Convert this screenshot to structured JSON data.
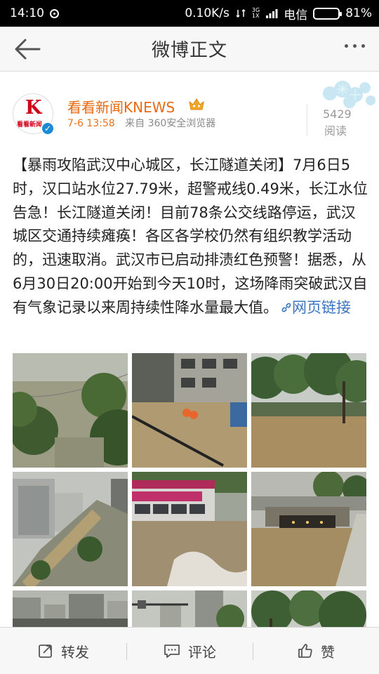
{
  "status_bar": {
    "time": "14:10",
    "net_speed": "0.10K/s",
    "net_type_top": "3G",
    "net_type_bottom": "1X",
    "carrier": "电信",
    "battery": "81%",
    "battery_level": 0.81
  },
  "nav": {
    "title": "微博正文"
  },
  "post": {
    "username": "看看新闻KNEWS",
    "date": "7-6 13:58",
    "source": "来自 360安全浏览器",
    "read_count": "5429",
    "read_label": "阅读",
    "avatar_logo": "K",
    "avatar_text": "看看新闻",
    "text": "【暴雨攻陷武汉中心城区，长江隧道关闭】7月6日5时，汉口站水位27.79米，超警戒线0.49米，长江水位告急！长江隧道关闭！目前78条公交线路停运，武汉城区交通持续瘫痪！各区各学校仍然有组织教学活动的，迅速取消。武汉市已启动排渍红色预警！据悉，从6月30日20:00开始到今天10时，这场降雨突破武汉自有气象记录以来周持续性降水量最大值。",
    "link_text": "网页链接",
    "images": [
      "photo-flooded-riverside",
      "photo-street-rescue",
      "photo-flooded-park",
      "photo-aerial-flooded-road",
      "photo-bus-in-flood",
      "photo-flooded-tunnel",
      "photo-city-buildings",
      "photo-street-lamp",
      "photo-trees"
    ]
  },
  "actions": {
    "repost": "转发",
    "comment": "评论",
    "like": "赞"
  }
}
